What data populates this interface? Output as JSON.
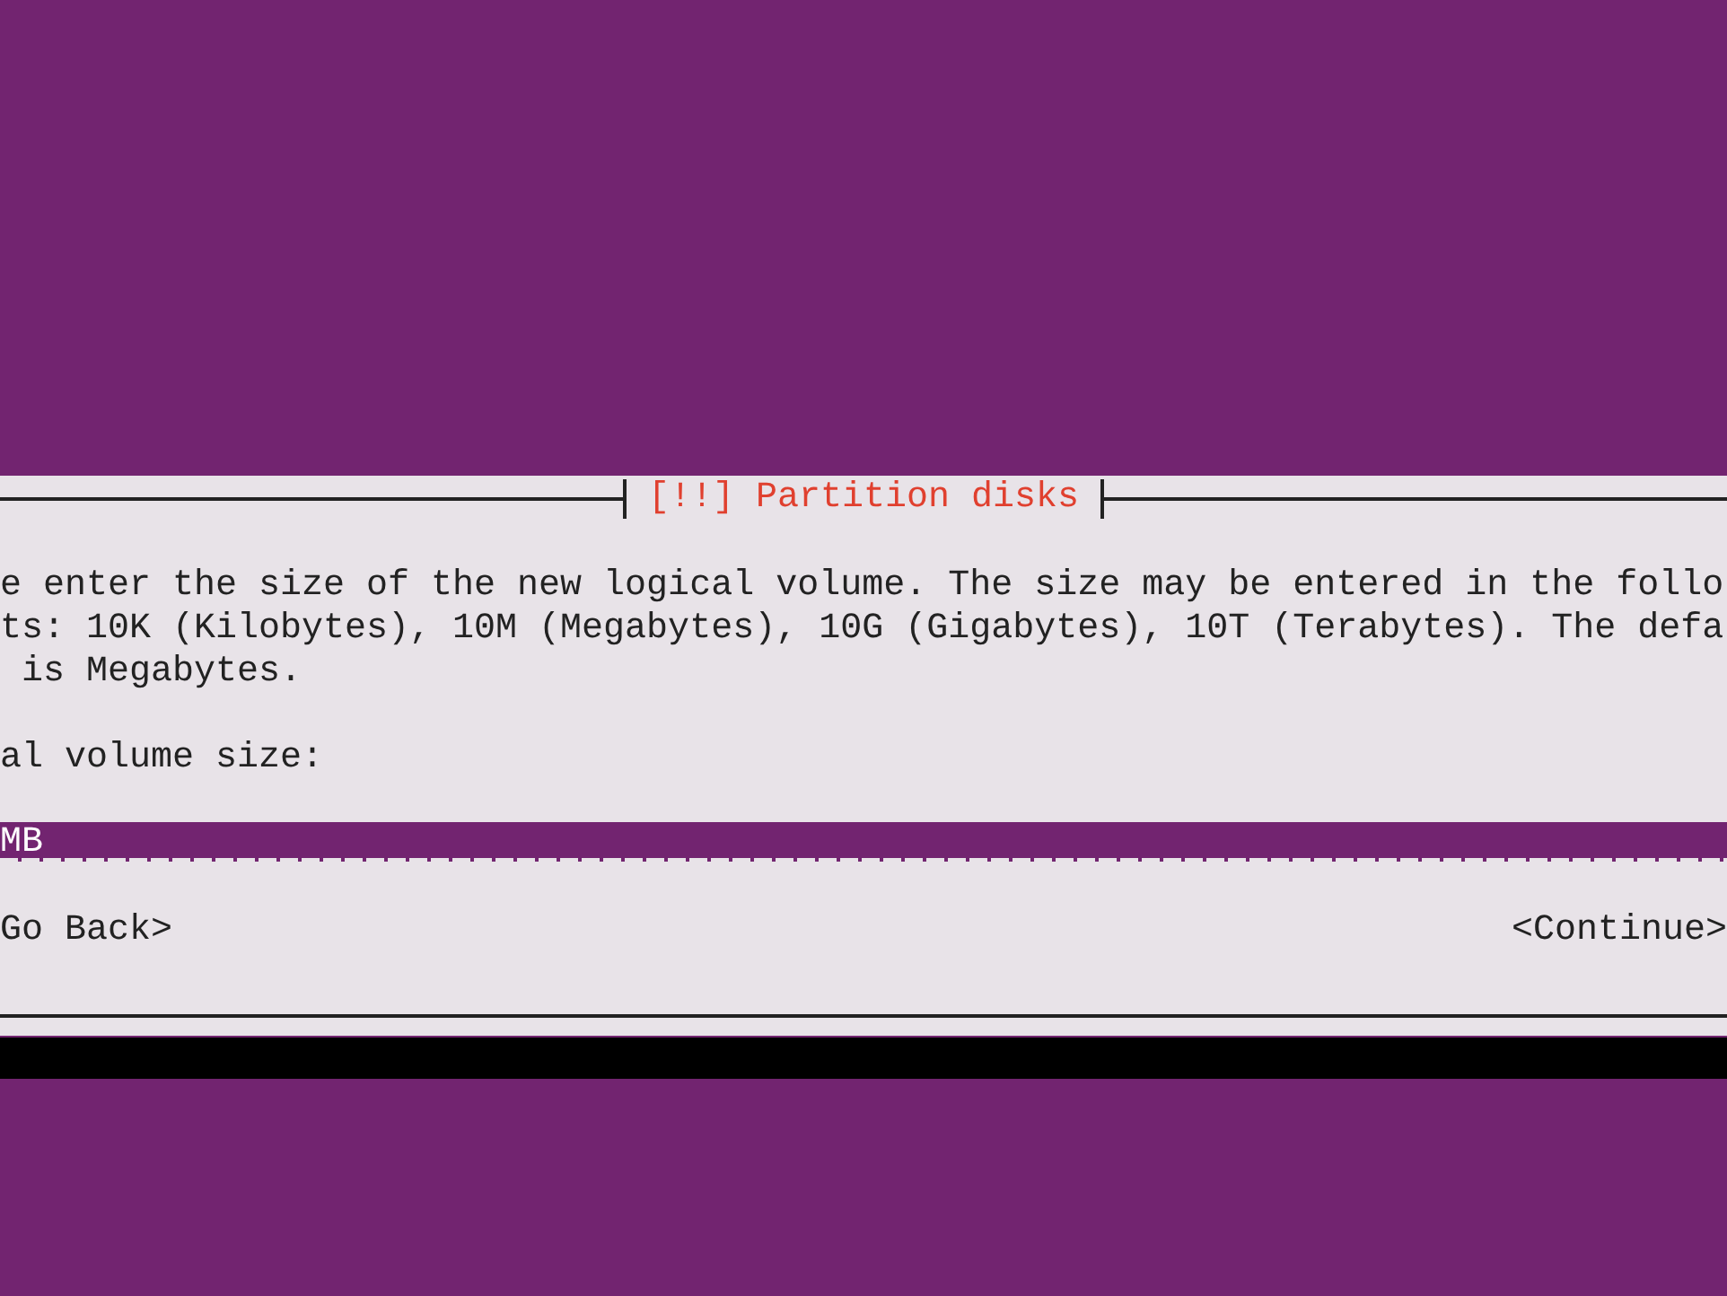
{
  "dialog": {
    "title": "[!!] Partition disks",
    "description": [
      "e enter the size of the new logical volume. The size may be entered in the follo",
      "ts: 10K (Kilobytes), 10M (Megabytes), 10G (Gigabytes), 10T (Terabytes). The defa",
      " is Megabytes."
    ],
    "field_label": "al volume size:",
    "field": {
      "value": "MB"
    },
    "buttons": [
      "Go Back>",
      "<Continue>"
    ]
  }
}
